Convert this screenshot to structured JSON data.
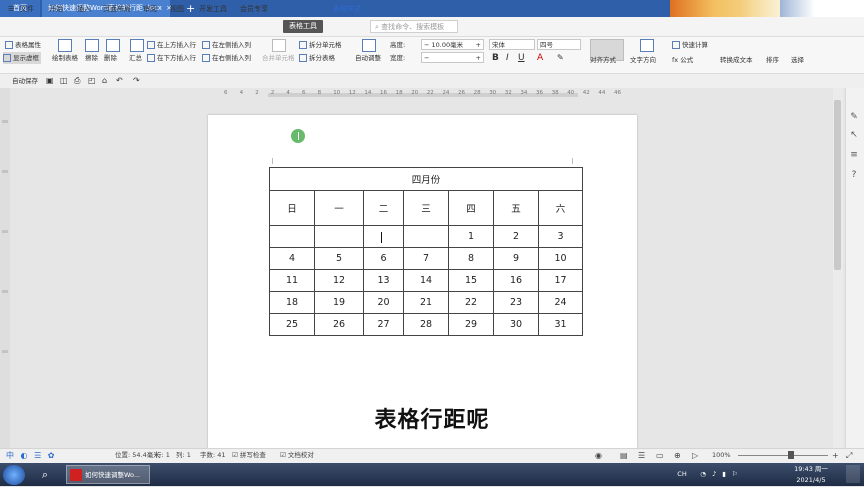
{
  "titlebar": {
    "home_tab": "首页",
    "doc_tab": "如何快速调整Word表格的行距.docx",
    "doc_tab_close": "×",
    "new_tab": "+"
  },
  "menubar": {
    "file": "文件",
    "items": [
      "开始",
      "插入",
      "页面布局",
      "审阅",
      "视图",
      "开发工具",
      "会员专享"
    ],
    "active": "表格工具",
    "table_style": "表格样式",
    "search_placeholder": "查找命令、搜索模板"
  },
  "ribbon": {
    "table_props": "表格属性",
    "show_gridlines": "显示虚框",
    "draw_table": "绘制表格",
    "erase": "擦除",
    "delete": "删除",
    "summary": "汇总",
    "insert_above": "在上方插入行",
    "insert_below": "在下方插入行",
    "insert_left": "在左侧插入列",
    "insert_right": "在右侧插入列",
    "merge_cells": "合并单元格",
    "split_cells": "拆分单元格",
    "split_table": "拆分表格",
    "auto_fit": "自动调整",
    "height_label": "高度:",
    "height_value": "10.00毫米",
    "width_label": "宽度:",
    "width_value": "",
    "font_name": "宋体",
    "font_size": "四号",
    "bold": "B",
    "italic": "I",
    "underline": "U",
    "font_color": "A",
    "align": "对齐方式",
    "text_direction": "文字方向",
    "formula": "fx 公式",
    "quick_calc": "快速计算",
    "to_text": "转换成文本",
    "sort": "排序",
    "select": "选择"
  },
  "quickbar": {
    "autosave": "自动保存"
  },
  "ruler": {
    "numbers": [
      "6",
      "4",
      "2",
      "2",
      "4",
      "6",
      "8",
      "10",
      "12",
      "14",
      "16",
      "18",
      "20",
      "22",
      "24",
      "26",
      "28",
      "30",
      "32",
      "34",
      "36",
      "38",
      "40",
      "42",
      "44",
      "46"
    ]
  },
  "calendar": {
    "title": "四月份",
    "weekdays": [
      "日",
      "一",
      "二",
      "三",
      "四",
      "五",
      "六"
    ],
    "weeks": [
      [
        "",
        "",
        "",
        "",
        "1",
        "2",
        "3"
      ],
      [
        "4",
        "5",
        "6",
        "7",
        "8",
        "9",
        "10"
      ],
      [
        "11",
        "12",
        "13",
        "14",
        "15",
        "16",
        "17"
      ],
      [
        "18",
        "19",
        "20",
        "21",
        "22",
        "23",
        "24"
      ],
      [
        "25",
        "26",
        "27",
        "28",
        "29",
        "30",
        "31"
      ]
    ]
  },
  "subtitle": "表格行距呢",
  "statusbar": {
    "position": "位置: 54.4毫米",
    "row": "行: 1",
    "col": "列: 1",
    "wordcount": "字数: 41",
    "spellcheck": "拼写检查",
    "doccheck": "文档校对",
    "zoom": "100%"
  },
  "taskbar": {
    "app": "如何快速调整Wo...",
    "time": "19:43 周一",
    "date": "2021/4/5",
    "ime": "CH"
  },
  "colors": {
    "titlebar": "#2f5fa8",
    "accent_green": "#4caf50",
    "active_menu": "#555555"
  }
}
